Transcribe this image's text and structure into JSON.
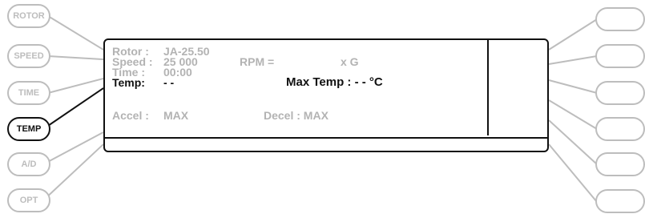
{
  "left_buttons": [
    {
      "label": "ROTOR",
      "active": false
    },
    {
      "label": "SPEED",
      "active": false
    },
    {
      "label": "TIME",
      "active": false
    },
    {
      "label": "TEMP",
      "active": true
    },
    {
      "label": "A/D",
      "active": false
    },
    {
      "label": "OPT",
      "active": false
    }
  ],
  "display": {
    "rotor_label": "Rotor :",
    "rotor_value": "JA-25.50",
    "speed_label": "Speed :",
    "speed_value": "25 000",
    "rpm_label": "RPM =",
    "xg_label": "x G",
    "time_label": "Time :",
    "time_value": "00:00",
    "temp_label": "Temp:",
    "temp_value": "- -",
    "max_temp": "Max Temp : - - °C",
    "accel_label": "Accel :",
    "accel_value": "MAX",
    "decel": "Decel : MAX"
  },
  "colors": {
    "inactive": "#bdbdbd",
    "active": "#111111"
  }
}
